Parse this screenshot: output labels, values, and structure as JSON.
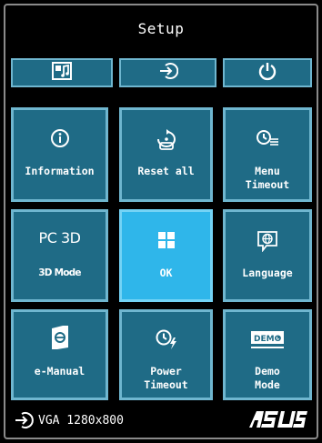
{
  "header": {
    "title": "Setup"
  },
  "shortcuts": [
    {
      "icon": "splendid-mode-icon"
    },
    {
      "icon": "input-select-icon"
    },
    {
      "icon": "power-icon"
    }
  ],
  "tiles": [
    {
      "label": "Information",
      "icon": "info-icon"
    },
    {
      "label": "Reset all",
      "icon": "reset-all-icon"
    },
    {
      "label": "Menu\nTimeout",
      "icon": "menu-timeout-icon"
    },
    {
      "label": "3D Mode",
      "icon_text": "PC 3D",
      "icon": "pc-3d-icon"
    },
    {
      "label": "OK",
      "icon": "ok-grid-icon",
      "selected": true
    },
    {
      "label": "Language",
      "icon": "language-icon"
    },
    {
      "label": "e-Manual",
      "icon": "e-manual-icon"
    },
    {
      "label": "Power\nTimeout",
      "icon": "power-timeout-icon"
    },
    {
      "label": "Demo\nMode",
      "icon": "demo-mode-icon",
      "icon_text": "DEMO"
    }
  ],
  "status": {
    "input": "VGA 1280x800"
  },
  "brand": {
    "logo_text": "ASUS"
  },
  "colors": {
    "tile_bg": "#1f6b86",
    "tile_border": "#6fb6cf",
    "selected_bg": "#2fb6ea",
    "background": "#000000"
  }
}
